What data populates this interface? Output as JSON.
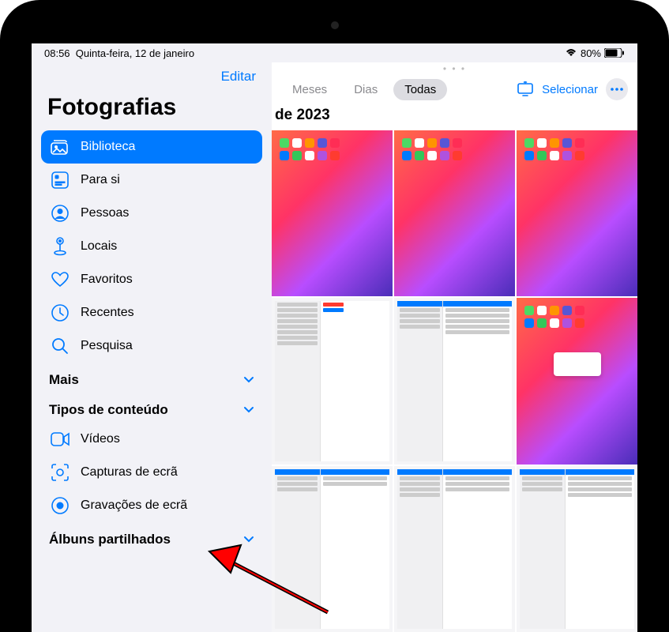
{
  "status": {
    "time": "08:56",
    "date": "Quinta-feira, 12 de janeiro",
    "battery_pct": "80%"
  },
  "sidebar": {
    "edit": "Editar",
    "title": "Fotografias",
    "items": {
      "biblioteca": "Biblioteca",
      "para_si": "Para si",
      "pessoas": "Pessoas",
      "locais": "Locais",
      "favoritos": "Favoritos",
      "recentes": "Recentes",
      "pesquisa": "Pesquisa"
    },
    "sections": {
      "mais": "Mais",
      "tipos": "Tipos de conteúdo",
      "albuns": "Álbuns partilhados"
    },
    "content_types": {
      "videos": "Vídeos",
      "capturas": "Capturas de ecrã",
      "gravacoes": "Gravações de ecrã"
    }
  },
  "main": {
    "tabs": {
      "meses": "Meses",
      "dias": "Dias",
      "todas": "Todas"
    },
    "date_header": "de 2023",
    "select": "Selecionar"
  },
  "colors": {
    "accent": "#007aff",
    "bg": "#f2f2f7"
  }
}
